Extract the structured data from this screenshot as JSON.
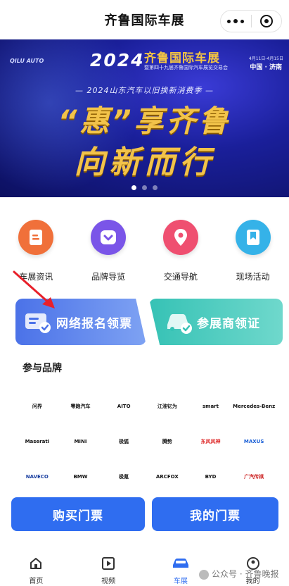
{
  "header": {
    "title": "齐鲁国际车展"
  },
  "banner": {
    "logo_text": "QILU AUTO",
    "year": "2024",
    "show_name": "齐鲁国际车展",
    "subtitle": "暨第四十九届齐鲁国际汽车展览交易会",
    "date": "4月11日-4月15日",
    "location": "中国 · 济南",
    "tagline": "— 2024山东汽车以旧换新消费季 —",
    "headline1": "“惠”享齐鲁",
    "headline2": "向新而行",
    "slide_count": 3,
    "active_slide": 1
  },
  "quick_links": [
    {
      "label": "车展资讯",
      "icon": "document-icon",
      "color": "#f0703a"
    },
    {
      "label": "品牌导览",
      "icon": "heart-shield-icon",
      "color": "#7a55e8"
    },
    {
      "label": "交通导航",
      "icon": "location-pin-icon",
      "color": "#ef4f70"
    },
    {
      "label": "现场活动",
      "icon": "bookmark-star-icon",
      "color": "#35b2e8"
    }
  ],
  "cards": {
    "register": "网络报名领票",
    "exhibitor": "参展商领证"
  },
  "brands": {
    "title": "参与品牌",
    "logos": [
      "问界",
      "零跑汽车",
      "AITO",
      "江淮钇为",
      "smart",
      "Mercedes-Benz",
      "Maserati",
      "MINI",
      "极狐",
      "腾势",
      "东风风神",
      "MAXUS",
      "NAVECO",
      "BMW",
      "极氪",
      "ARCFOX",
      "BYD",
      "广汽传祺"
    ]
  },
  "buttons": {
    "buy": "购买门票",
    "mine": "我的门票"
  },
  "tabbar": {
    "items": [
      {
        "label": "首页",
        "icon": "home-icon"
      },
      {
        "label": "视频",
        "icon": "play-icon"
      },
      {
        "label": "车展",
        "icon": "car-icon"
      },
      {
        "label": "我的",
        "icon": "user-icon"
      }
    ],
    "active": "车展"
  },
  "watermark": "公众号 · 齐鲁晚报",
  "colors": {
    "primary": "#2f6df0",
    "register_card": "#4b72e8",
    "exhibitor_card": "#36c2b5",
    "banner_gold": "#f2c34a"
  }
}
